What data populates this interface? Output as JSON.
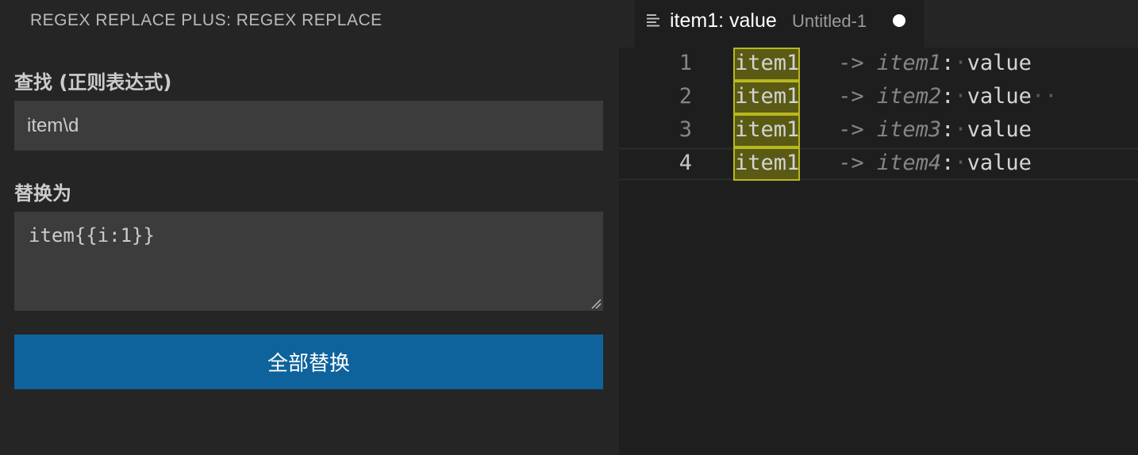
{
  "panel": {
    "title": "REGEX REPLACE PLUS: REGEX REPLACE",
    "find_label": "查找 (正则表达式)",
    "find_value": "item\\d",
    "replace_label": "替换为",
    "replace_value": "item{{i:1}}",
    "replace_all_label": "全部替换"
  },
  "editor": {
    "tab_title": "item1: value",
    "tab_description": "Untitled-1",
    "lines": [
      {
        "number": "1",
        "match": "item1",
        "arrow": "->",
        "comment": "item1",
        "colon": ":",
        "value": "value",
        "trailing": ""
      },
      {
        "number": "2",
        "match": "item1",
        "arrow": "->",
        "comment": "item2",
        "colon": ":",
        "value": "value",
        "trailing": "··"
      },
      {
        "number": "3",
        "match": "item1",
        "arrow": "->",
        "comment": "item3",
        "colon": ":",
        "value": "value",
        "trailing": ""
      },
      {
        "number": "4",
        "match": "item1",
        "arrow": "->",
        "comment": "item4",
        "colon": ":",
        "value": "value",
        "trailing": ""
      }
    ]
  },
  "colors": {
    "accent_button": "#0e639c",
    "find_match_bg": "#5a5a14",
    "find_match_border": "#b8b820"
  }
}
